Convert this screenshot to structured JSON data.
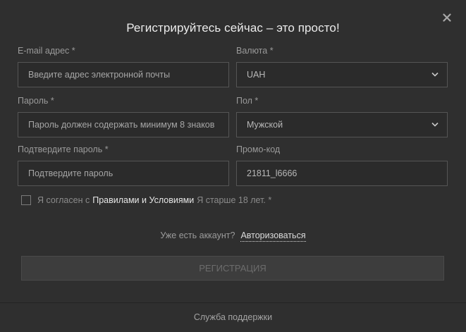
{
  "modal": {
    "title": "Регистрируйтесь сейчас – это просто!"
  },
  "fields": {
    "email": {
      "label": "E-mail адрес *",
      "placeholder": "Введите адрес электронной почты"
    },
    "currency": {
      "label": "Валюта *",
      "value": "UAH"
    },
    "password": {
      "label": "Пароль *",
      "placeholder": "Пароль должен содержать минимум 8 знаков"
    },
    "gender": {
      "label": "Пол *",
      "value": "Мужской"
    },
    "confirm_password": {
      "label": "Подтвердите пароль *",
      "placeholder": "Подтвердите пароль"
    },
    "promo": {
      "label": "Промо-код",
      "value": "21811_l6666"
    }
  },
  "agreement": {
    "prefix": "Я согласен с",
    "link": "Правилами и Условиями",
    "suffix": "Я старше 18 лет. *"
  },
  "login": {
    "question": "Уже есть аккаунт?",
    "link": "Авторизоваться"
  },
  "register_button": "РЕГИСТРАЦИЯ",
  "footer": {
    "support": "Служба поддержки"
  },
  "icons": {
    "close": "close-icon",
    "select": "chevron-down-icon"
  },
  "colors": {
    "background": "#2f2f2f",
    "border": "#555555",
    "button_bg": "#3d3d3d",
    "title": "#ececec"
  }
}
